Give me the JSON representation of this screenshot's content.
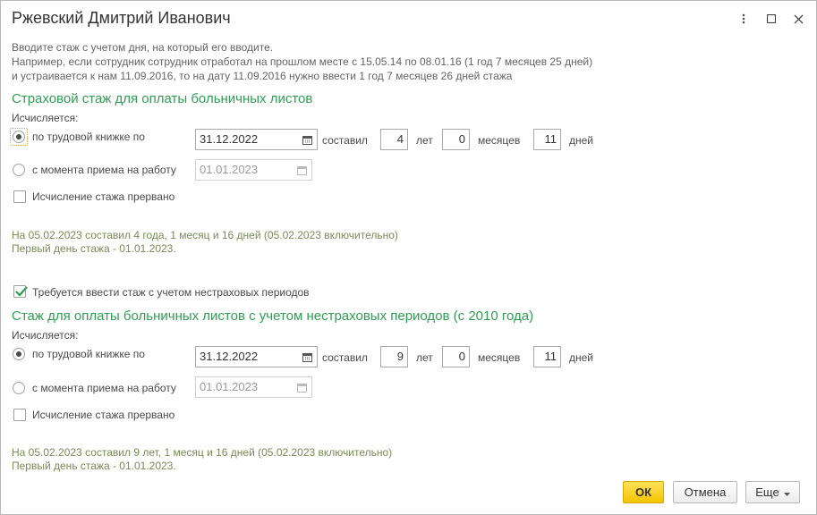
{
  "window": {
    "title": "Ржевский Дмитрий Иванович",
    "menu_icon": "more-vertical-icon",
    "maximize_icon": "maximize-icon",
    "close_icon": "close-icon"
  },
  "hint": {
    "line1": "Вводите стаж с учетом дня, на который его вводите.",
    "line2": "Например, если сотрудник сотрудник отработал на прошлом месте с 15.05.14 по 08.01.16 (1 год 7 месяцев 25 дней)",
    "line3": "и устраивается к нам 11.09.2016, то на дату 11.09.2016 нужно ввести 1 год 7 месяцев 26 дней стажа"
  },
  "section1": {
    "title": "Страховой стаж для оплаты больничных листов",
    "calculated_label": "Исчисляется:",
    "radio_workbook": "по трудовой книжке по",
    "radio_hire": "с момента приема на работу",
    "workbook_date": "31.12.2022",
    "hire_date": "01.01.2023",
    "composed_label": "составил",
    "years": "4",
    "years_label": "лет",
    "months": "0",
    "months_label": "месяцев",
    "days": "11",
    "days_label": "дней",
    "interrupted_label": "Исчисление стажа прервано",
    "info_line1": "На 05.02.2023 составил 4 года, 1 месяц и 16 дней (05.02.2023 включительно)",
    "info_line2": "Первый день стажа - 01.01.2023."
  },
  "nonins_checkbox_label": "Требуется ввести стаж с учетом нестраховых периодов",
  "section2": {
    "title": "Стаж для оплаты больничных листов с учетом нестраховых периодов (с 2010 года)",
    "calculated_label": "Исчисляется:",
    "radio_workbook": "по трудовой книжке по",
    "radio_hire": "с момента приема на работу",
    "workbook_date": "31.12.2022",
    "hire_date": "01.01.2023",
    "composed_label": "составил",
    "years": "9",
    "years_label": "лет",
    "months": "0",
    "months_label": "месяцев",
    "days": "11",
    "days_label": "дней",
    "interrupted_label": "Исчисление стажа прервано",
    "info_line1": "На 05.02.2023 составил 9 лет, 1 месяц и 16 дней (05.02.2023 включительно)",
    "info_line2": "Первый день стажа - 01.01.2023."
  },
  "buttons": {
    "ok": "ОК",
    "cancel": "Отмена",
    "more": "Еще"
  },
  "colors": {
    "section_title": "#2f9e54",
    "ok_button": "#f4c400",
    "info_text": "#7a8a57"
  }
}
